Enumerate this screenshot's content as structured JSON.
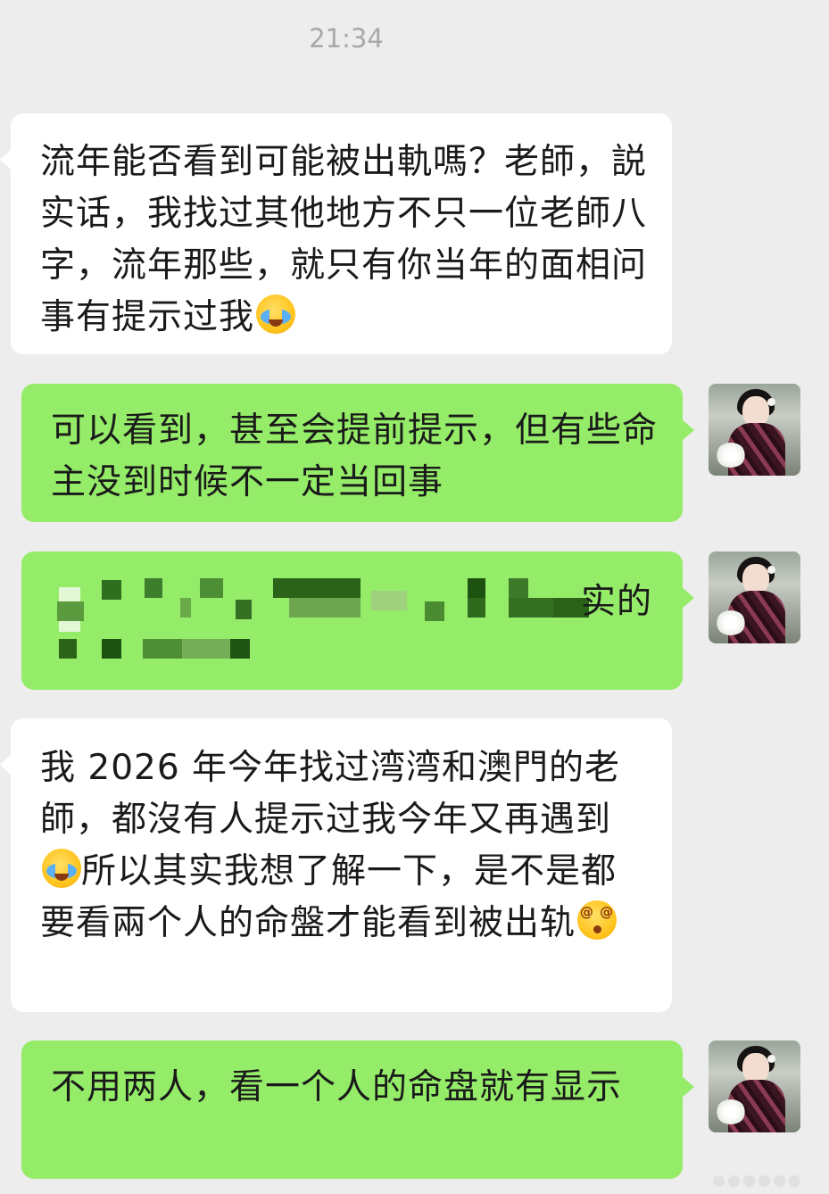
{
  "timestamp": "21:34",
  "messages": [
    {
      "side": "in",
      "text": "流年能否看到可能被出軌嗎？老師，説实话，我找过其他地方不只一位老師八字，流年那些，就只有你当年的面相问事有提示过我",
      "emoji": "crying-face-emoji"
    },
    {
      "side": "out",
      "text": "可以看到，甚至会提前提示，但有些命主没到时候不一定当回事"
    },
    {
      "side": "out",
      "text": "实的",
      "blurred": true
    },
    {
      "side": "in",
      "text_before": "我 2026 年今年找过湾湾和澳門的老師，都沒有人提示过我今年又再遇到",
      "emoji": "crying-face-emoji",
      "text_after": "所以其实我想了解一下，是不是都要看兩个人的命盤才能看到被出轨",
      "emoji_end": "dizzy-face-emoji"
    },
    {
      "side": "out",
      "text": "不用两人，看一个人的命盘就有显示"
    }
  ],
  "colors": {
    "background": "#ededed",
    "incoming_bubble": "#ffffff",
    "outgoing_bubble": "#95ec69",
    "time_text": "#a8a8a8"
  }
}
